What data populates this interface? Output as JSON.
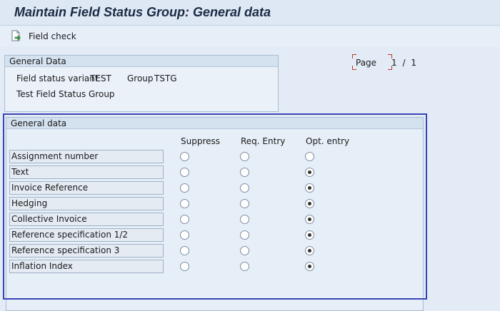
{
  "window": {
    "title": "Maintain Field Status Group: General data"
  },
  "toolbar": {
    "field_check_label": "Field check",
    "field_check_icon": "document-check-icon"
  },
  "general_data_box": {
    "header": "General Data",
    "field_status_variant_label": "Field status variant",
    "field_status_variant_value": "TEST",
    "group_label": "Group",
    "group_value": "TSTG",
    "description": "Test Field Status Group"
  },
  "page_indicator": {
    "label": "Page",
    "current": "1",
    "separator": "/",
    "total": "1"
  },
  "general_data_section": {
    "header": "General data",
    "columns": [
      "Suppress",
      "Req. Entry",
      "Opt. entry"
    ],
    "fields": [
      {
        "label": "Assignment number",
        "selected": "none"
      },
      {
        "label": "Text",
        "selected": "Opt. entry"
      },
      {
        "label": "Invoice Reference",
        "selected": "Opt. entry"
      },
      {
        "label": "Hedging",
        "selected": "Opt. entry"
      },
      {
        "label": "Collective Invoice",
        "selected": "Opt. entry"
      },
      {
        "label": "Reference specification 1/2",
        "selected": "Opt. entry"
      },
      {
        "label": "Reference specification 3",
        "selected": "Opt. entry"
      },
      {
        "label": "Inflation Index",
        "selected": "Opt. entry"
      }
    ]
  },
  "colors": {
    "focus_frame": "#3a45b5",
    "title_text": "#1b2a44",
    "page_corner": "#c0392b"
  }
}
